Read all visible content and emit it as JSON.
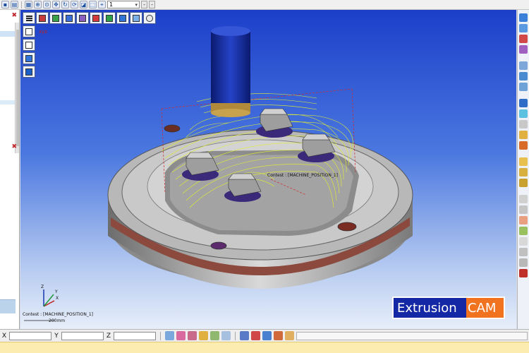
{
  "toolbar": {
    "zoom_value": "1",
    "zoom_chevron": "▾"
  },
  "viewport": {
    "context_label": "Contest : [MACHINE_POSITION_1]",
    "triad_context": "Contest : [MACHINE_POSITION_1]",
    "triad_scale": "200mm",
    "axes": {
      "x": "X",
      "y": "Y",
      "z": "Z"
    }
  },
  "brand": {
    "part1": "Extrusion",
    "part2": "CAM"
  },
  "bottom": {
    "x_label": "X",
    "y_label": "Y",
    "z_label": "Z",
    "x_value": "",
    "y_value": "",
    "z_value": ""
  },
  "colors": {
    "viewport_top": "#1c3fc9",
    "brand_blue": "#1428a6",
    "brand_orange": "#f2731f",
    "toolpath": "#e4f22b",
    "status_strip": "#fdecb0"
  },
  "icons": {
    "top_toolbar": [
      "save-icon",
      "print-icon",
      "layers-icon",
      "zoom-all-icon",
      "zoom-window-icon",
      "pan-icon",
      "rotate-icon",
      "refresh-icon",
      "view-icon",
      "select-icon",
      "measure-icon"
    ],
    "view_toolbar": [
      "menu-icon",
      "cube-iso-icon",
      "cube-front-icon",
      "cube-top-icon",
      "cube-right-icon",
      "cube-left-icon",
      "cube-back-icon",
      "cube-bottom-icon",
      "cube-shaded-icon",
      "zoom-fit-icon"
    ],
    "right_toolbar": [
      "solid-icon",
      "surface-icon",
      "curve-icon",
      "point-icon",
      "feature-icon",
      "toolpath-icon",
      "tool-icon",
      "machine-icon",
      "simulate-icon",
      "verify-icon",
      "post-icon",
      "nc-icon",
      "drill-icon",
      "mill-icon",
      "contour-icon",
      "pocket-icon",
      "hatch-icon",
      "finish-icon",
      "engrave-icon",
      "probe-icon",
      "lathe-icon",
      "turn-icon",
      "report-icon"
    ],
    "bottom_toolbar": [
      "select-point-icon",
      "select-edge-icon",
      "select-face-icon",
      "select-solid-icon",
      "select-body-icon",
      "pick-icon",
      "settings-icon",
      "chart-icon",
      "stats-icon",
      "export-icon",
      "user-icon"
    ]
  }
}
